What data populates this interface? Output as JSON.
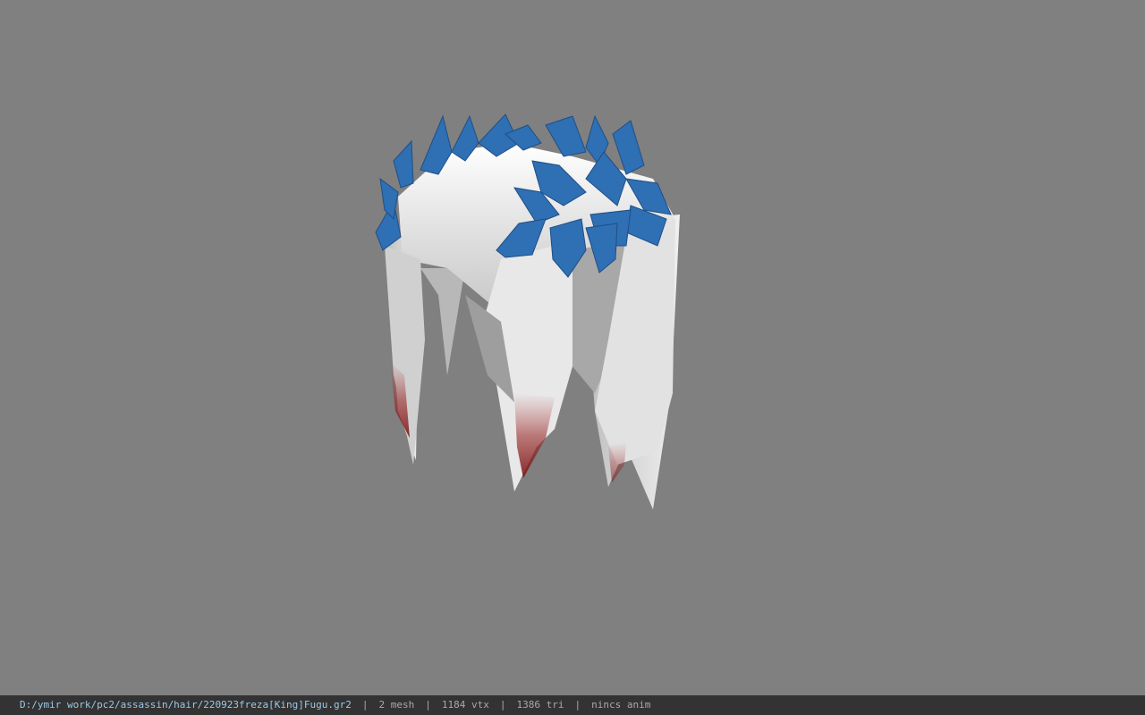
{
  "viewport": {
    "background_color": "#808080",
    "model_description_icon": "hair-model-icon"
  },
  "statusbar": {
    "file_path": "D:/ymir work/pc2/assassin/hair/220923freza[King]Fugu.gr2",
    "mesh_count": "2 mesh",
    "vertex_count": "1184 vtx",
    "triangle_count": "1386 tri",
    "anim_label": "nincs anim",
    "separator": "|"
  },
  "colors": {
    "leaf_blue": "#2f6fb3",
    "hair_white": "#e6e6e6",
    "blood_red": "#8a1d1d",
    "statusbar_bg": "#333333",
    "path_color": "#9cc8e6"
  }
}
